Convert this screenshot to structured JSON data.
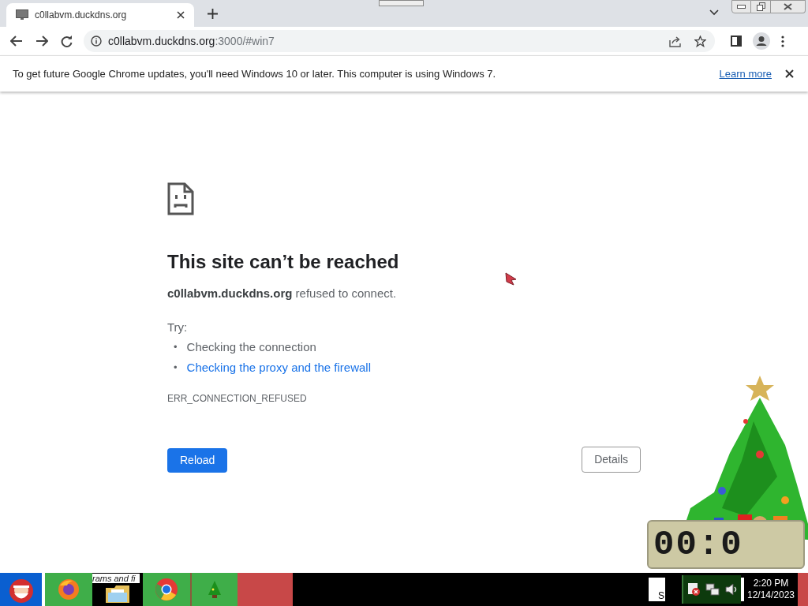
{
  "tab": {
    "title": "c0llabvm.duckdns.org",
    "selected": true
  },
  "address_bar": {
    "host": "c0llabvm.duckdns.org",
    "path": ":3000/#win7"
  },
  "infobar": {
    "message": "To get future Google Chrome updates, you'll need Windows 10 or later. This computer is using Windows 7.",
    "link": "Learn more"
  },
  "error_page": {
    "title": "This site can’t be reached",
    "message": "**c0llabvm.duckdns.org** refused to connect.",
    "try_label": "Try:",
    "suggestions": [
      {
        "bullet": "•",
        "text": "Checking the connection",
        "kind": "text"
      },
      {
        "bullet": "•",
        "text": "Checking the proxy and the firewall",
        "kind": "link"
      }
    ],
    "error_code": "ERR_CONNECTION_REFUSED",
    "buttons": [
      {
        "label": "Reload",
        "kind": "primary"
      },
      {
        "label": "Details",
        "kind": "secondary"
      }
    ]
  },
  "desktop_clock": {
    "digits": "00:0"
  },
  "taskbar": {
    "partial_text": "rams and fi",
    "tray_box_text": "S",
    "time": "2:20 PM",
    "date": "12/14/2023"
  }
}
